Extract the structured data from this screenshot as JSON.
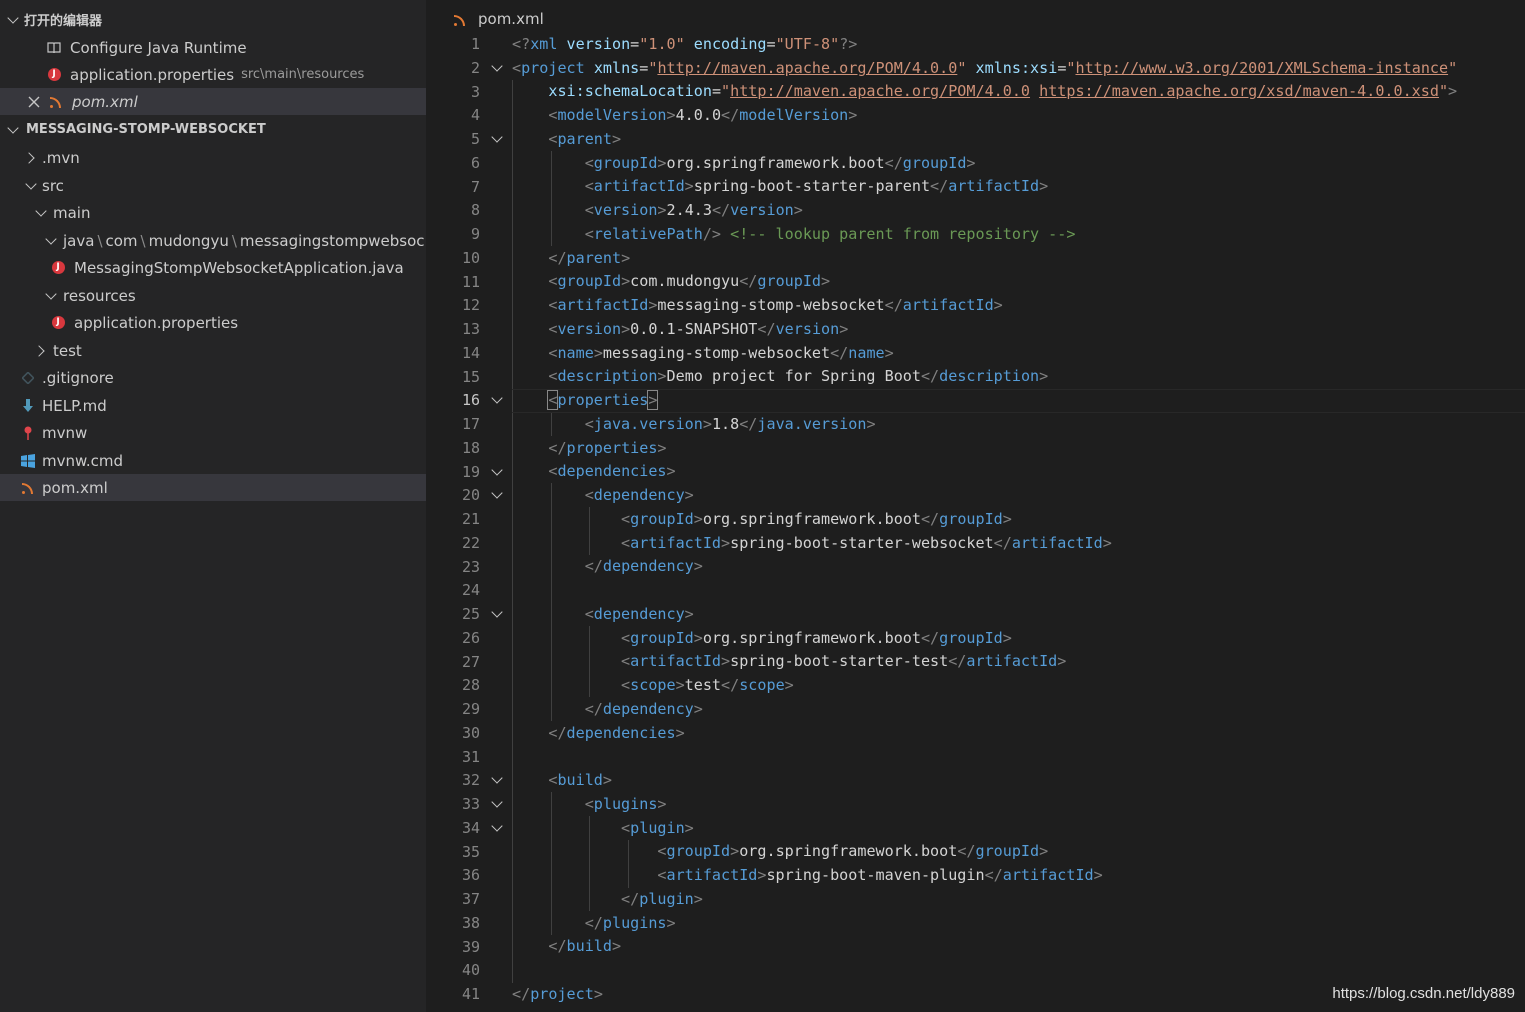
{
  "sidebar": {
    "open_editors_title": "打开的编辑器",
    "open_editors": [
      {
        "label": "Configure Java Runtime",
        "desc": "",
        "icon": "book-icon"
      },
      {
        "label": "application.properties",
        "desc": "src\\main\\resources",
        "icon": "spring-icon"
      },
      {
        "label": "pom.xml",
        "desc": "",
        "icon": "rss-xml-icon"
      }
    ],
    "project_title": "MESSAGING-STOMP-WEBSOCKET",
    "tree": [
      {
        "label": ".mvn"
      },
      {
        "label": "src"
      },
      {
        "label": "main"
      },
      {
        "label_parts": [
          "java",
          "com",
          "mudongyu",
          "messagingstompwebsoc..."
        ],
        "sep": "\\"
      },
      {
        "label": "MessagingStompWebsocketApplication.java"
      },
      {
        "label": "resources"
      },
      {
        "label": "application.properties"
      },
      {
        "label": "test"
      },
      {
        "label": ".gitignore"
      },
      {
        "label": "HELP.md"
      },
      {
        "label": "mvnw"
      },
      {
        "label": "mvnw.cmd"
      },
      {
        "label": "pom.xml"
      }
    ]
  },
  "editor": {
    "breadcrumb": "pom.xml",
    "current_line": 16,
    "line_count": 41
  },
  "watermark": "https://blog.csdn.net/ldy889",
  "colors": {
    "tag": "#569cd6",
    "attr": "#9cdcfe",
    "string": "#ce9178",
    "text": "#d4d4d4",
    "comment": "#6a9955",
    "punct": "#808080"
  }
}
